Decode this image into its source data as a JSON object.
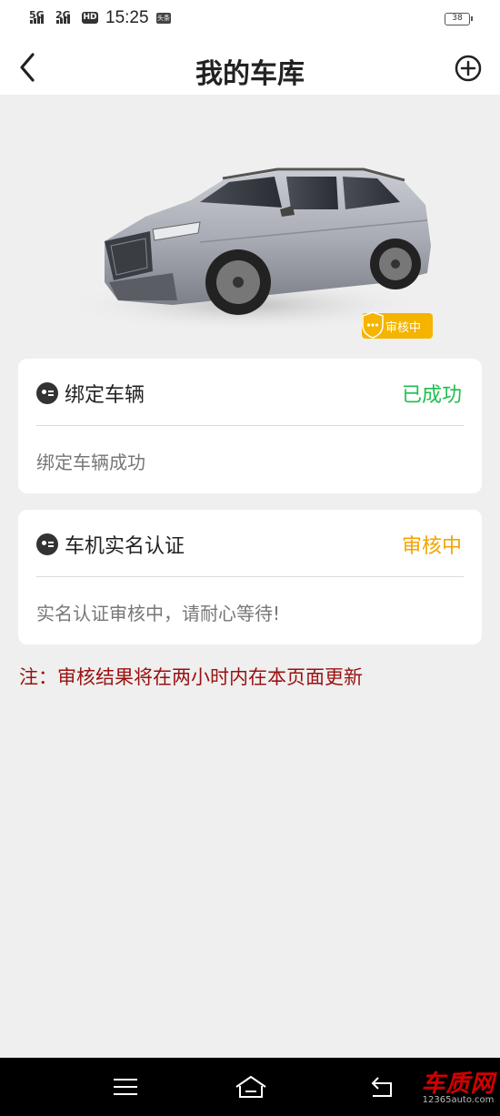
{
  "statusbar": {
    "signal1": "5G",
    "signal2": "2G",
    "hd": "HD",
    "time": "15:25",
    "app_icon": "头条",
    "battery": "38"
  },
  "header": {
    "title": "我的车库",
    "back_icon": "chevron-left-icon",
    "add_icon": "plus-circle-icon"
  },
  "vehicle": {
    "badge_label": "审核中"
  },
  "cards": [
    {
      "title": "绑定车辆",
      "status": "已成功",
      "status_color": "#1dbf4f",
      "description": "绑定车辆成功"
    },
    {
      "title": "车机实名认证",
      "status": "审核中",
      "status_color": "#f4a300",
      "description": "实名认证审核中，请耐心等待!"
    }
  ],
  "note": "注：审核结果将在两小时内在本页面更新",
  "navbar": {
    "menu_icon": "menu-icon",
    "home_icon": "home-icon",
    "back_icon": "back-icon"
  },
  "watermark": {
    "name": "车质网",
    "url": "12365auto.com"
  }
}
